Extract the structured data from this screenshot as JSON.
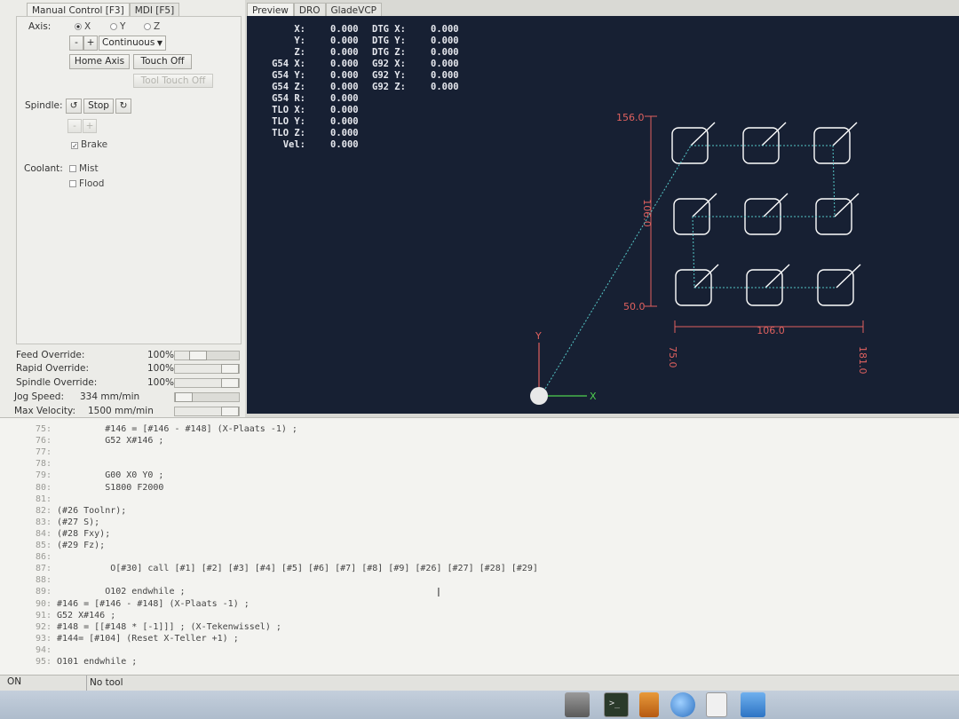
{
  "left_tabs": [
    "Manual Control [F3]",
    "MDI [F5]"
  ],
  "manual": {
    "axis_label": "Axis:",
    "axes": [
      {
        "label": "X",
        "selected": true
      },
      {
        "label": "Y",
        "selected": false
      },
      {
        "label": "Z",
        "selected": false
      }
    ],
    "jog_minus": "-",
    "jog_plus": "+",
    "jog_mode": "Continuous",
    "home_axis": "Home Axis",
    "touch_off": "Touch Off",
    "tool_touch_off": "Tool Touch Off",
    "spindle_label": "Spindle:",
    "spindle_stop": "Stop",
    "spindle_minus": "-",
    "spindle_plus": "+",
    "brake_label": "Brake",
    "coolant_label": "Coolant:",
    "mist_label": "Mist",
    "flood_label": "Flood"
  },
  "overrides": [
    {
      "label": "Feed Override:",
      "value": "100%",
      "level": 0.5
    },
    {
      "label": "Rapid Override:",
      "value": "100%",
      "level": 1.0
    },
    {
      "label": "Spindle Override:",
      "value": "100%",
      "level": 1.0
    },
    {
      "label": "Jog Speed:",
      "value": "334 mm/min",
      "level": 0.22
    },
    {
      "label": "Max Velocity:",
      "value": "1500 mm/min",
      "level": 1.0
    }
  ],
  "preview_tabs": [
    "Preview",
    "DRO",
    "GladeVCP"
  ],
  "dro_left": [
    {
      "label": "X:",
      "value": "0.000"
    },
    {
      "label": "Y:",
      "value": "0.000"
    },
    {
      "label": "Z:",
      "value": "0.000"
    },
    {
      "label": "G54 X:",
      "value": "0.000"
    },
    {
      "label": "G54 Y:",
      "value": "0.000"
    },
    {
      "label": "G54 Z:",
      "value": "0.000"
    },
    {
      "label": "G54 R:",
      "value": "0.000"
    },
    {
      "label": "TLO X:",
      "value": "0.000"
    },
    {
      "label": "TLO Y:",
      "value": "0.000"
    },
    {
      "label": "TLO Z:",
      "value": "0.000"
    },
    {
      "label": "Vel:",
      "value": "0.000"
    }
  ],
  "dro_right": [
    {
      "label": "DTG X:",
      "value": "0.000"
    },
    {
      "label": "DTG Y:",
      "value": "0.000"
    },
    {
      "label": "DTG Z:",
      "value": "0.000"
    },
    {
      "label": "G92 X:",
      "value": "0.000"
    },
    {
      "label": "G92 Y:",
      "value": "0.000"
    },
    {
      "label": "G92 Z:",
      "value": "0.000"
    }
  ],
  "extents": {
    "y_max": "156.0",
    "y_min": "50.0",
    "y_size": "106.0",
    "x_size": "106.0",
    "x_min": "75.0",
    "x_max": "181.0"
  },
  "origin_axes": {
    "x": "X",
    "y": "Y"
  },
  "code_lines": [
    {
      "n": "75:",
      "t": "          #146 = [#146 - #148] (X-Plaats -1) ;"
    },
    {
      "n": "76:",
      "t": "          G52 X#146 ;"
    },
    {
      "n": "77:",
      "t": ""
    },
    {
      "n": "78:",
      "t": ""
    },
    {
      "n": "79:",
      "t": "          G00 X0 Y0 ;"
    },
    {
      "n": "80:",
      "t": "          S1800 F2000"
    },
    {
      "n": "81:",
      "t": ""
    },
    {
      "n": "82:",
      "t": " (#26 Toolnr);"
    },
    {
      "n": "83:",
      "t": " (#27 S);"
    },
    {
      "n": "84:",
      "t": " (#28 Fxy);"
    },
    {
      "n": "85:",
      "t": " (#29 Fz);"
    },
    {
      "n": "86:",
      "t": ""
    },
    {
      "n": "87:",
      "t": "           O[#30] call [#1] [#2] [#3] [#4] [#5] [#6] [#7] [#8] [#9] [#26] [#27] [#28] [#29]"
    },
    {
      "n": "88:",
      "t": ""
    },
    {
      "n": "89:",
      "t": "          O102 endwhile ;"
    },
    {
      "n": "90:",
      "t": " #146 = [#146 - #148] (X-Plaats -1) ;"
    },
    {
      "n": "91:",
      "t": " G52 X#146 ;"
    },
    {
      "n": "92:",
      "t": " #148 = [[#148 * [-1]]] ; (X-Tekenwissel) ;"
    },
    {
      "n": "93:",
      "t": " #144= [#104] (Reset X-Teller +1) ;"
    },
    {
      "n": "94:",
      "t": ""
    },
    {
      "n": "95:",
      "t": " O101 endwhile ;"
    }
  ],
  "status": {
    "machine": "ON",
    "tool": "No tool"
  },
  "taskbar": [
    {
      "icon": "laptop-icon"
    },
    {
      "icon": "terminal-icon"
    },
    {
      "icon": "archive-icon"
    },
    {
      "icon": "browser-globe-icon"
    },
    {
      "icon": "file-search-icon"
    },
    {
      "icon": "folder-icon"
    }
  ]
}
